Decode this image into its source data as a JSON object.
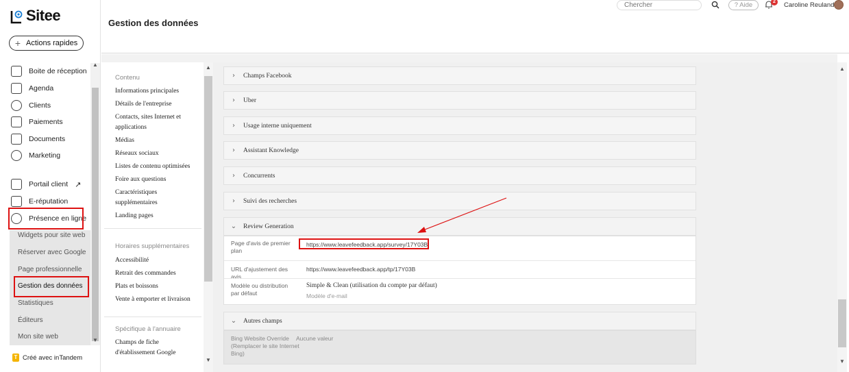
{
  "app": {
    "logo_text": "Sitee",
    "quick_actions": "Actions rapides",
    "made_with": "Créé avec inTandem"
  },
  "sidebar": {
    "items": [
      {
        "label": "Boite de réception"
      },
      {
        "label": "Agenda"
      },
      {
        "label": "Clients"
      },
      {
        "label": "Paiements"
      },
      {
        "label": "Documents"
      },
      {
        "label": "Marketing"
      },
      {
        "label": "Portail client"
      },
      {
        "label": "E-réputation"
      },
      {
        "label": "Présence en ligne"
      }
    ],
    "subitems": [
      {
        "label": "Widgets pour site web"
      },
      {
        "label": "Réserver avec Google"
      },
      {
        "label": "Page professionnelle"
      },
      {
        "label": "Gestion des données"
      },
      {
        "label": "Statistiques"
      },
      {
        "label": "Éditeurs"
      },
      {
        "label": "Mon site web"
      }
    ]
  },
  "header": {
    "page_title": "Gestion des données",
    "search_placeholder": "Chercher",
    "help": "? Aide",
    "notif_count": "2",
    "user_name": "Caroline Reuland"
  },
  "content_nav": {
    "section1_title": "Contenu",
    "section1_items": [
      "Informations principales",
      "Détails de l'entreprise",
      "Contacts, sites Internet et applications",
      "Médias",
      "Réseaux sociaux",
      "Listes de contenu optimisées",
      "Foire aux questions",
      "Caractéristiques supplémentaires",
      "Landing pages"
    ],
    "section2_title": "Horaires supplémentaires",
    "section2_items": [
      "Accessibilité",
      "Retrait des commandes",
      "Plats et boissons",
      "Vente à emporter et livraison"
    ],
    "section3_title": "Spécifique à l'annuaire",
    "section3_items": [
      "Champs de fiche d'établissement Google"
    ]
  },
  "accordions": [
    "Champs Facebook",
    "Uber",
    "Usage interne uniquement",
    "Assistant Knowledge",
    "Concurrents",
    "Suivi des recherches"
  ],
  "review_generation": {
    "title": "Review Generation",
    "rows": [
      {
        "label": "Page d'avis de premier plan",
        "value": "https://www.leavefeedback.app/survey/17Y03B"
      },
      {
        "label": "URL d'ajustement des avis",
        "value": "https://www.leavefeedback.app/tp/17Y03B"
      },
      {
        "label": "Modèle ou distribution par défaut",
        "value": "Simple & Clean (utilisation du compte par défaut)",
        "sub": "Modèle d'e-mail"
      }
    ]
  },
  "other_fields": {
    "title": "Autres champs",
    "rows": [
      {
        "label": "Bing Website Override (Remplacer le site Internet Bing)",
        "value": "Aucune valeur"
      }
    ]
  },
  "colors": {
    "highlight": "#dd1111",
    "accent": "#1a7fd4"
  }
}
